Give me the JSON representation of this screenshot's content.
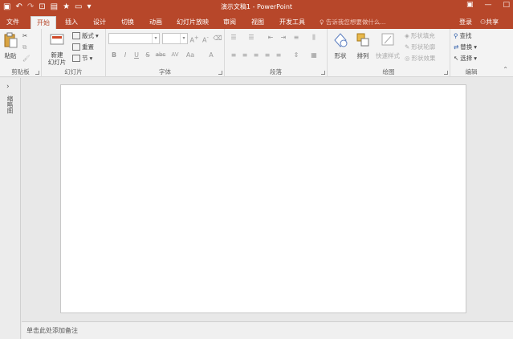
{
  "app": {
    "title": "演示文稿1 - PowerPoint",
    "accent_color": "#b7472a"
  },
  "qat": {
    "icons": [
      "save-icon",
      "undo-icon",
      "redo-icon",
      "presenter-icon",
      "picture-icon",
      "star-icon",
      "slide-icon",
      "customize-icon"
    ]
  },
  "tabs": [
    "文件",
    "开始",
    "插入",
    "设计",
    "切换",
    "动画",
    "幻灯片放映",
    "审阅",
    "视图",
    "开发工具"
  ],
  "active_tab": "开始",
  "tellme": "告诉我您想要做什么...",
  "account": {
    "signin": "登录",
    "share": "共享"
  },
  "ribbon": {
    "clipboard": {
      "label": "剪贴板",
      "paste": "粘贴"
    },
    "slides": {
      "label": "幻灯片",
      "new_slide": "新建\n幻灯片",
      "layout": "版式",
      "reset": "重置",
      "section": "节"
    },
    "font": {
      "label": "字体",
      "buttons": [
        "B",
        "I",
        "U",
        "S",
        "abc",
        "AV",
        "Aa",
        "A"
      ]
    },
    "paragraph": {
      "label": "段落"
    },
    "drawing": {
      "label": "绘图",
      "shape": "形状",
      "arrange": "排列",
      "quick_styles": "快速样式",
      "shape_fill": "形状填充",
      "shape_outline": "形状轮廓",
      "shape_effects": "形状效果"
    },
    "editing": {
      "label": "编辑",
      "find": "查找",
      "replace": "替换",
      "select": "选择"
    }
  },
  "thumbnail_pane": {
    "label": "缩略图"
  },
  "notes": {
    "placeholder": "单击此处添加备注"
  }
}
